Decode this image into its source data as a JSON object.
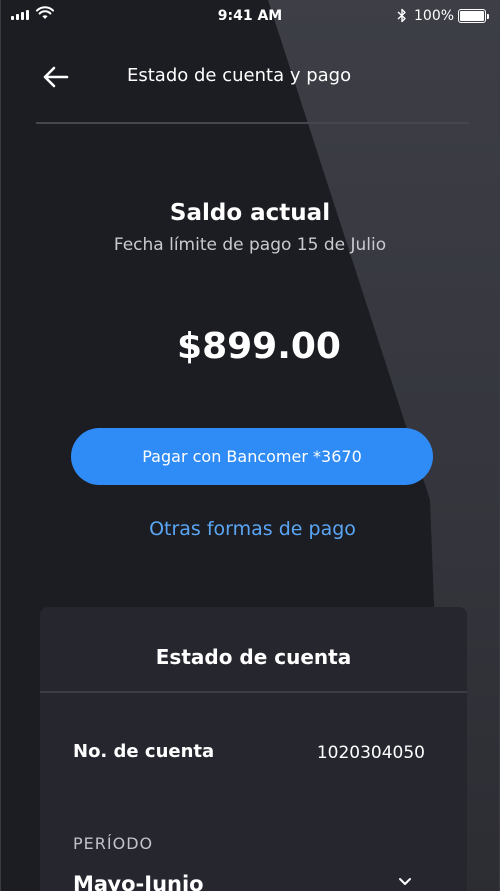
{
  "status_bar": {
    "time": "9:41 AM",
    "battery_percent": "100%"
  },
  "header": {
    "title": "Estado de cuenta y pago"
  },
  "balance": {
    "title": "Saldo actual",
    "due_date": "Fecha límite de pago 15 de Julio",
    "amount": "$899.00"
  },
  "actions": {
    "primary_pay_label": "Pagar con Bancomer *3670",
    "other_payment_label": "Otras formas de pago"
  },
  "statement": {
    "title": "Estado de cuenta",
    "account_label": "No. de cuenta",
    "account_number": "1020304050",
    "period_label": "PERÍODO",
    "period_value": "Mayo-Junio"
  },
  "colors": {
    "background": "#1c1d22",
    "accent": "#2f8bf5",
    "link": "#5aa6f5",
    "card": "#26272e"
  },
  "icons": [
    "signal-icon",
    "wifi-icon",
    "bluetooth-icon",
    "battery-icon",
    "back-arrow-icon",
    "chevron-down-icon"
  ]
}
